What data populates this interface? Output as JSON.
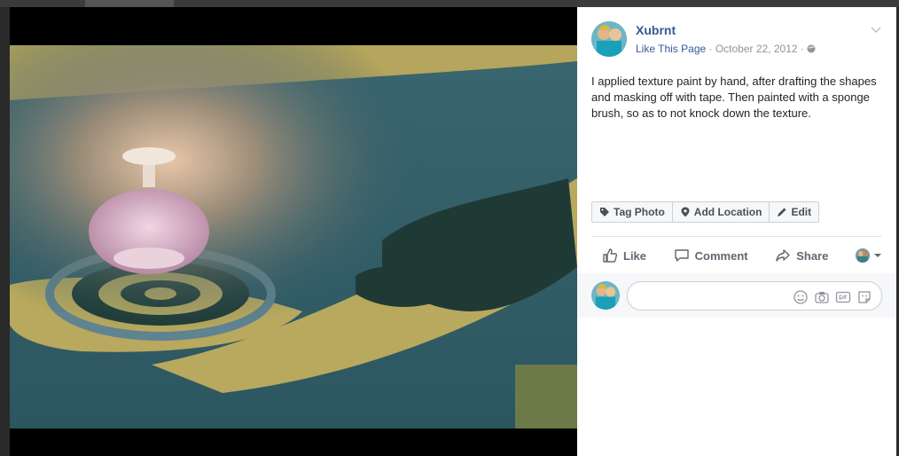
{
  "post": {
    "author": "Xubrnt",
    "like_page": "Like This Page",
    "meta_sep": " · ",
    "date": "October 22, 2012",
    "caption": "I applied texture paint by hand, after drafting the shapes and masking off with tape. Then painted with a sponge brush, so as to not knock down the texture."
  },
  "photo_actions": {
    "tag_photo": "Tag Photo",
    "add_location": "Add Location",
    "edit": "Edit"
  },
  "ufi": {
    "like": "Like",
    "comment": "Comment",
    "share": "Share"
  },
  "comment": {
    "value": "",
    "placeholder": ""
  },
  "colors": {
    "link_blue": "#365899",
    "meta_gray": "#90949c",
    "text": "#1d2129",
    "button_text": "#606770",
    "ceiling_teal": "#2e5a66",
    "texture_yellow": "#b8a95e",
    "stencil_dark": "#1f3a35"
  },
  "icons": {
    "globe": "globe-icon",
    "chevron": "chevron-down-icon",
    "tag": "tag-icon",
    "location": "location-pin-icon",
    "edit": "pencil-icon",
    "like": "thumbs-up-icon",
    "comment": "comment-bubble-icon",
    "share": "share-arrow-icon",
    "emoji": "emoji-icon",
    "camera": "camera-icon",
    "gif": "gif-icon",
    "sticker": "sticker-icon"
  }
}
